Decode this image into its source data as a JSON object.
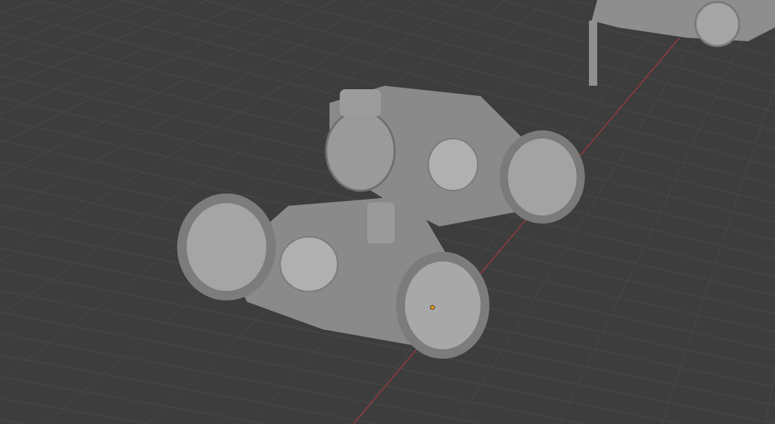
{
  "viewport": {
    "show_grid": true,
    "show_x_axis": true,
    "show_origin": true
  }
}
